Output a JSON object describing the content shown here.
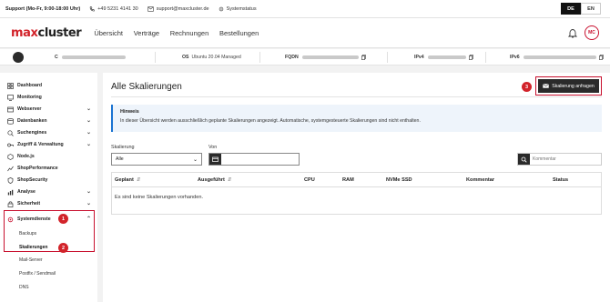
{
  "topbar": {
    "support": "Support (Mo-Fr, 9:00-18:00 Uhr)",
    "phone": "+49 5231 4141 30",
    "email": "support@maxcluster.de",
    "status": "Systemstatus",
    "lang_de": "DE",
    "lang_en": "EN"
  },
  "header": {
    "logo_max": "max",
    "logo_cluster": "cluster",
    "nav": [
      "Übersicht",
      "Verträge",
      "Rechnungen",
      "Bestellungen"
    ],
    "avatar": "MC"
  },
  "serverbar": {
    "c_label": "C",
    "os_label": "OS",
    "os_value": "Ubuntu 20.04 Managed",
    "fqdn_label": "FQDN",
    "ipv4_label": "IPv4",
    "ipv6_label": "IPv6"
  },
  "sidebar": {
    "items": [
      {
        "label": "Dashboard"
      },
      {
        "label": "Monitoring"
      },
      {
        "label": "Webserver"
      },
      {
        "label": "Datenbanken"
      },
      {
        "label": "Suchengines"
      },
      {
        "label": "Zugriff & Verwaltung"
      },
      {
        "label": "Node.js"
      },
      {
        "label": "ShopPerformance"
      },
      {
        "label": "ShopSecurity"
      },
      {
        "label": "Analyse"
      },
      {
        "label": "Sicherheit"
      },
      {
        "label": "Systemdienste"
      }
    ],
    "subitems": [
      "Backups",
      "Skalierungen",
      "Mail-Server",
      "Postfix / Sendmail",
      "DNS"
    ],
    "badge1": "1",
    "badge2": "2"
  },
  "main": {
    "title": "Alle Skalierungen",
    "request_button": "Skalierung anfragen",
    "badge3": "3",
    "hint_title": "Hinweis",
    "hint_text": "In dieser Übersicht werden ausschließlich geplante Skalierungen angezeigt. Automatische, systemgesteuerte Skalierungen sind nicht enthalten.",
    "filter_label": "Skalierung",
    "filter_value": "Alle",
    "from_label": "Von",
    "search_placeholder": "Kommentar",
    "columns": [
      "Geplant",
      "Ausgeführt",
      "CPU",
      "RAM",
      "NVMe SSD",
      "Kommentar",
      "Status"
    ],
    "empty_text": "Es sind keine Skalierungen vorhanden."
  },
  "colors": {
    "accent": "#d2232a",
    "dark": "#2a2a2a",
    "info_border": "#1a73d1"
  }
}
